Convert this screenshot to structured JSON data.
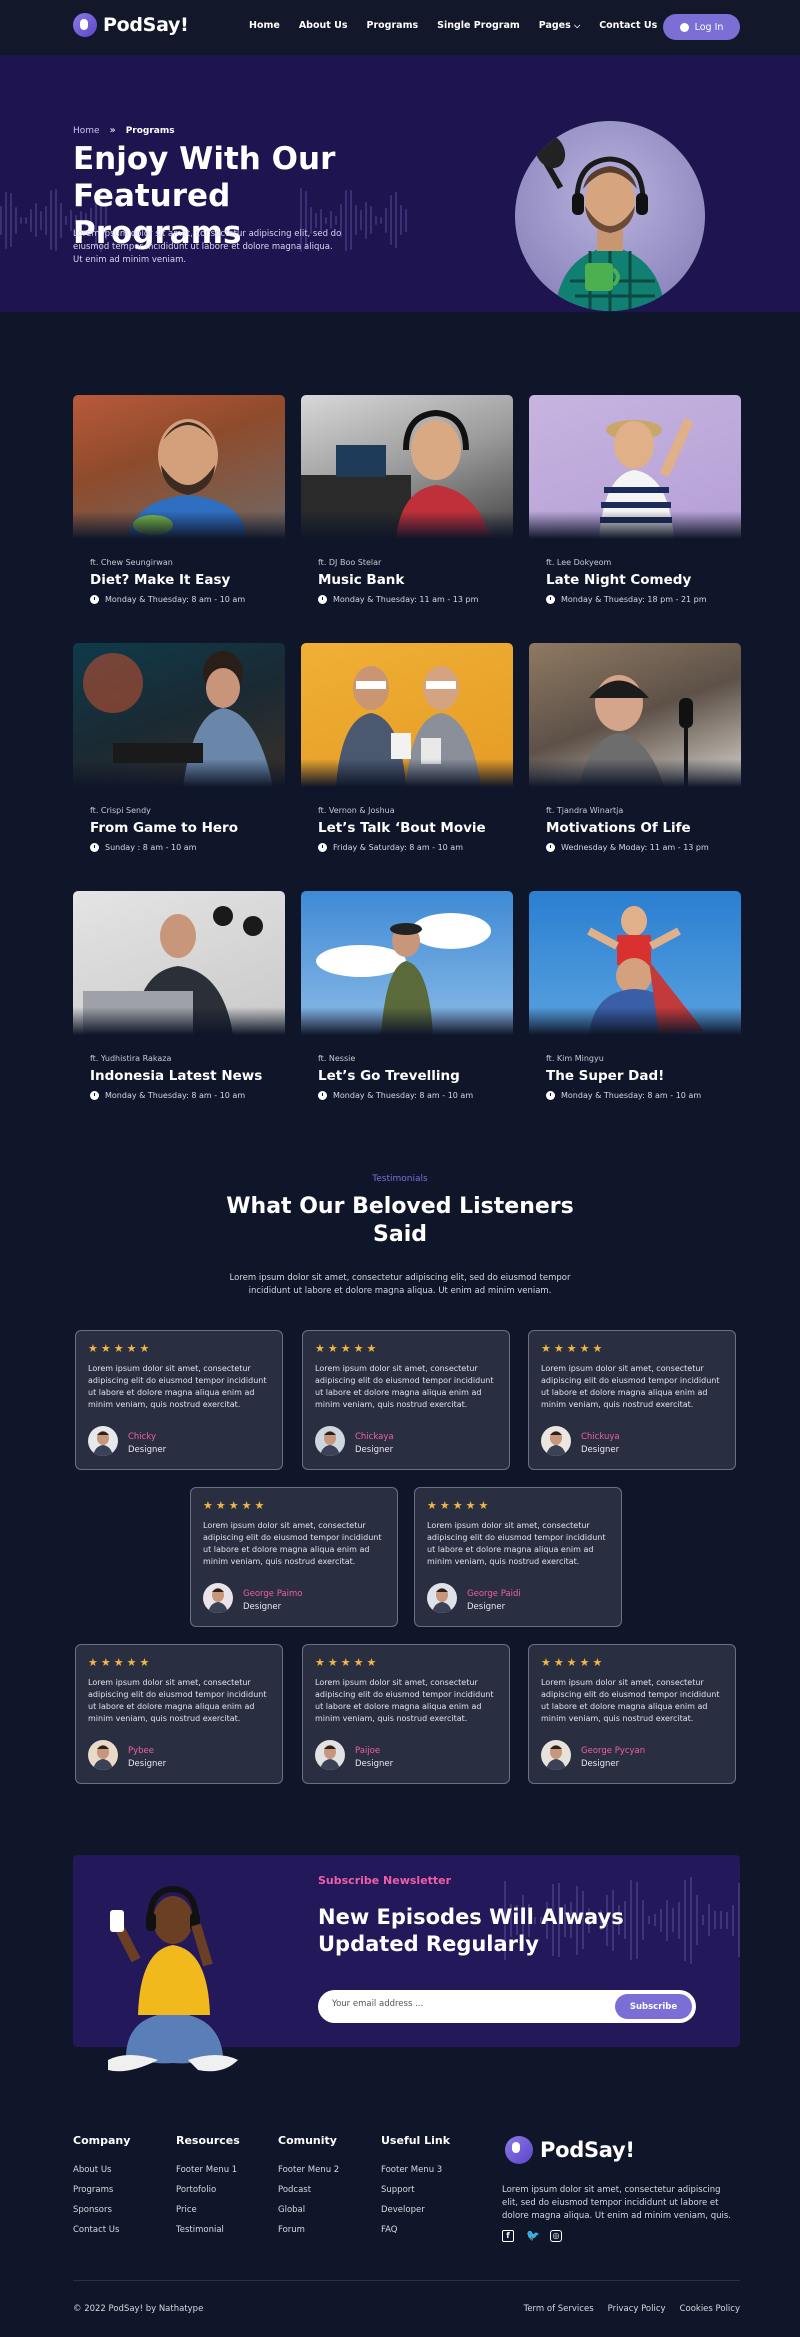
{
  "nav": {
    "brand": "PodSay!",
    "menu": [
      "Home",
      "About Us",
      "Programs",
      "Single Program",
      "Pages",
      "Contact Us"
    ],
    "login_label": "Log In"
  },
  "hero": {
    "breadcrumb_home": "Home",
    "breadcrumb_current": "Programs",
    "title": "Enjoy With Our Featured Programs",
    "description": "Lorem ipsum dolor sit amet, consectetur adipiscing elit, sed do eiusmod tempor incididunt ut labore et dolore magna aliqua. Ut enim ad minim veniam."
  },
  "programs": [
    {
      "host": "ft. Chew Seungirwan",
      "title": "Diet? Make It Easy",
      "time": "Monday & Thuesday: 8 am - 10 am"
    },
    {
      "host": "ft. DJ Boo Stelar",
      "title": "Music Bank",
      "time": "Monday & Thuesday: 11 am - 13 pm"
    },
    {
      "host": "ft. Lee Dokyeom",
      "title": "Late Night Comedy",
      "time": "Monday & Thuesday: 18 pm - 21 pm"
    },
    {
      "host": "ft. Crispi Sendy",
      "title": "From Game to Hero",
      "time": "Sunday : 8 am - 10 am"
    },
    {
      "host": "ft. Vernon & Joshua",
      "title": "Let’s Talk ‘Bout Movie",
      "time": "Friday & Saturday: 8 am - 10 am"
    },
    {
      "host": "ft. Tjandra Winartja",
      "title": "Motivations Of Life",
      "time": "Wednesday & Moday: 11 am - 13 pm"
    },
    {
      "host": "ft. Yudhistira Rakaza",
      "title": "Indonesia Latest News",
      "time": "Monday & Thuesday: 8 am - 10 am"
    },
    {
      "host": "ft. Nessie",
      "title": "Let’s Go Trevelling",
      "time": "Monday & Thuesday: 8 am - 10 am"
    },
    {
      "host": "ft. Kim Mingyu",
      "title": "The Super Dad!",
      "time": "Monday & Thuesday: 8 am - 10 am"
    }
  ],
  "testimonials": {
    "tag": "Testimonials",
    "title": "What Our Beloved Listeners Said",
    "description": "Lorem ipsum dolor sit amet, consectetur adipiscing elit, sed do eiusmod tempor incididunt ut labore et dolore magna aliqua. Ut enim ad minim veniam.",
    "stars": "★★★★★",
    "quote": "Lorem ipsum dolor sit amet, consectetur adipiscing elit do eiusmod tempor incididunt ut labore et dolore magna aliqua enim ad minim veniam, quis nostrud exercitat.",
    "items": [
      {
        "name": "Chicky",
        "role": "Designer"
      },
      {
        "name": "Chickaya",
        "role": "Designer"
      },
      {
        "name": "Chickuya",
        "role": "Designer"
      },
      {
        "name": "George Paimo",
        "role": "Designer"
      },
      {
        "name": "George Paidi",
        "role": "Designer"
      },
      {
        "name": "Pybee",
        "role": "Designer"
      },
      {
        "name": "Paijoe",
        "role": "Designer"
      },
      {
        "name": "George Pycyan",
        "role": "Designer"
      }
    ]
  },
  "newsletter": {
    "tag": "Subscribe Newsletter",
    "title": "New Episodes Will Always Updated Regularly",
    "placeholder": "Your email address ...",
    "button": "Subscribe"
  },
  "footer": {
    "columns": [
      {
        "heading": "Company",
        "links": [
          "About Us",
          "Programs",
          "Sponsors",
          "Contact Us"
        ]
      },
      {
        "heading": "Resources",
        "links": [
          "Footer Menu 1",
          "Portofolio",
          "Price",
          "Testimonial"
        ]
      },
      {
        "heading": "Comunity",
        "links": [
          "Footer Menu 2",
          "Podcast",
          "Global",
          "Forum"
        ]
      },
      {
        "heading": "Useful Link",
        "links": [
          "Footer Menu 3",
          "Support",
          "Developer",
          "FAQ"
        ]
      }
    ],
    "brand": "PodSay!",
    "description": "Lorem ipsum dolor sit amet, consectetur adipiscing elit, sed do eiusmod tempor incididunt ut labore et dolore magna aliqua. Ut enim ad minim veniam, quis.",
    "copyright": "© 2022 PodSay! by Nathatype",
    "legal": [
      "Term of Services",
      "Privacy Policy",
      "Cookies Policy"
    ]
  },
  "colors": {
    "background": "#0f1629",
    "hero": "#1e1550",
    "accent": "#7b6fd6",
    "pink": "#ef5fa7",
    "star": "#f2b543"
  }
}
